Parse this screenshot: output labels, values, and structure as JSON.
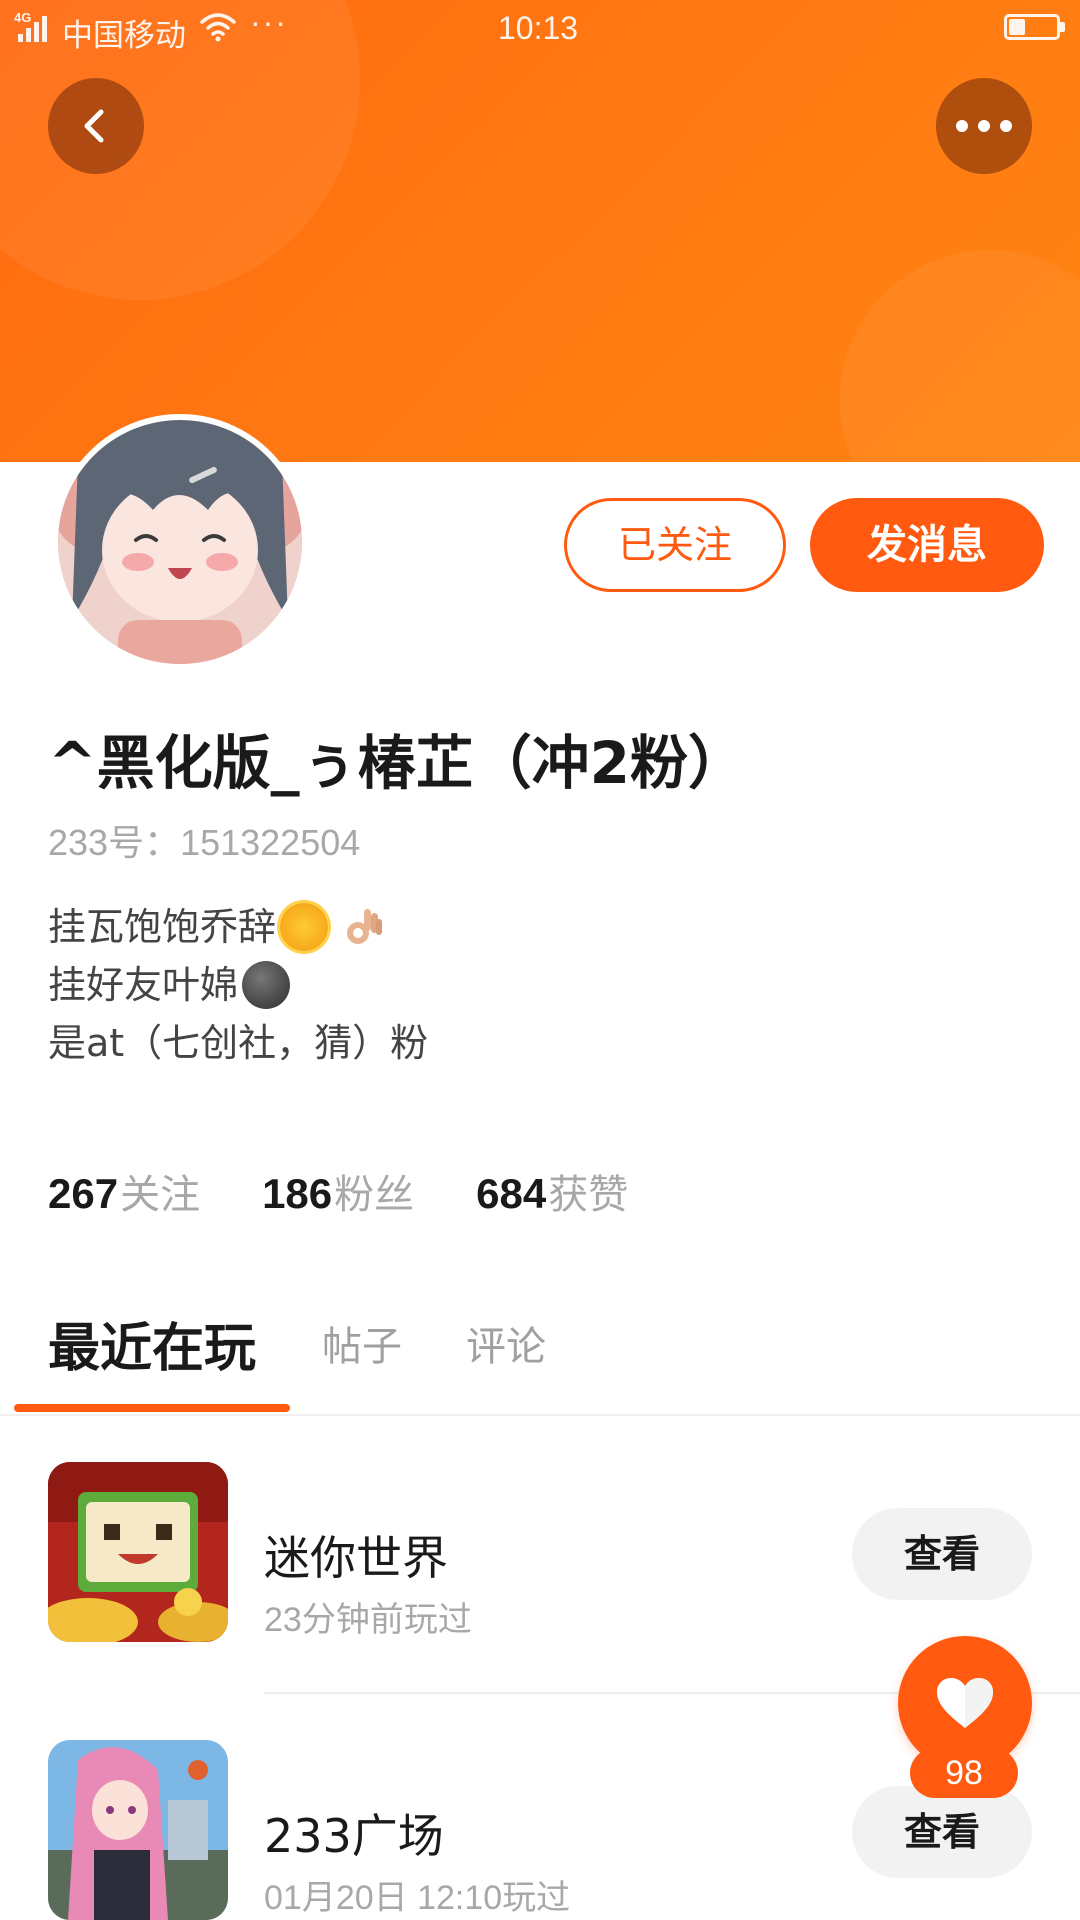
{
  "status_bar": {
    "network": "4G",
    "carrier": "中国移动",
    "more": "···",
    "time": "10:13",
    "battery_level": 0.35
  },
  "header": {
    "back_icon": "chevron-left-icon",
    "more_icon": "more-horizontal-icon",
    "banner_color": "#ff7410"
  },
  "profile": {
    "follow_button": "已关注",
    "message_button": "发消息",
    "username": "^黑化版_ぅ椿芷（冲2粉）",
    "user_id": "233号：151322504",
    "bio_lines": [
      "挂瓦饱饱乔辞",
      "挂好友叶婂",
      "是at（七创社，猜）粉"
    ]
  },
  "stats": [
    {
      "value": "267",
      "label": "关注"
    },
    {
      "value": "186",
      "label": "粉丝"
    },
    {
      "value": "684",
      "label": "获赞"
    }
  ],
  "tabs": [
    {
      "label": "最近在玩",
      "active": true
    },
    {
      "label": "帖子",
      "active": false
    },
    {
      "label": "评论",
      "active": false
    }
  ],
  "games": [
    {
      "name": "迷你世界",
      "time": "23分钟前玩过",
      "action": "查看"
    },
    {
      "name": "233广场",
      "time": "01月20日 12:10玩过",
      "action": "查看"
    }
  ],
  "fab": {
    "icon": "heart-icon",
    "count": "98"
  },
  "colors": {
    "accent": "#ff5a0f",
    "muted_text": "#a8a8a8"
  }
}
